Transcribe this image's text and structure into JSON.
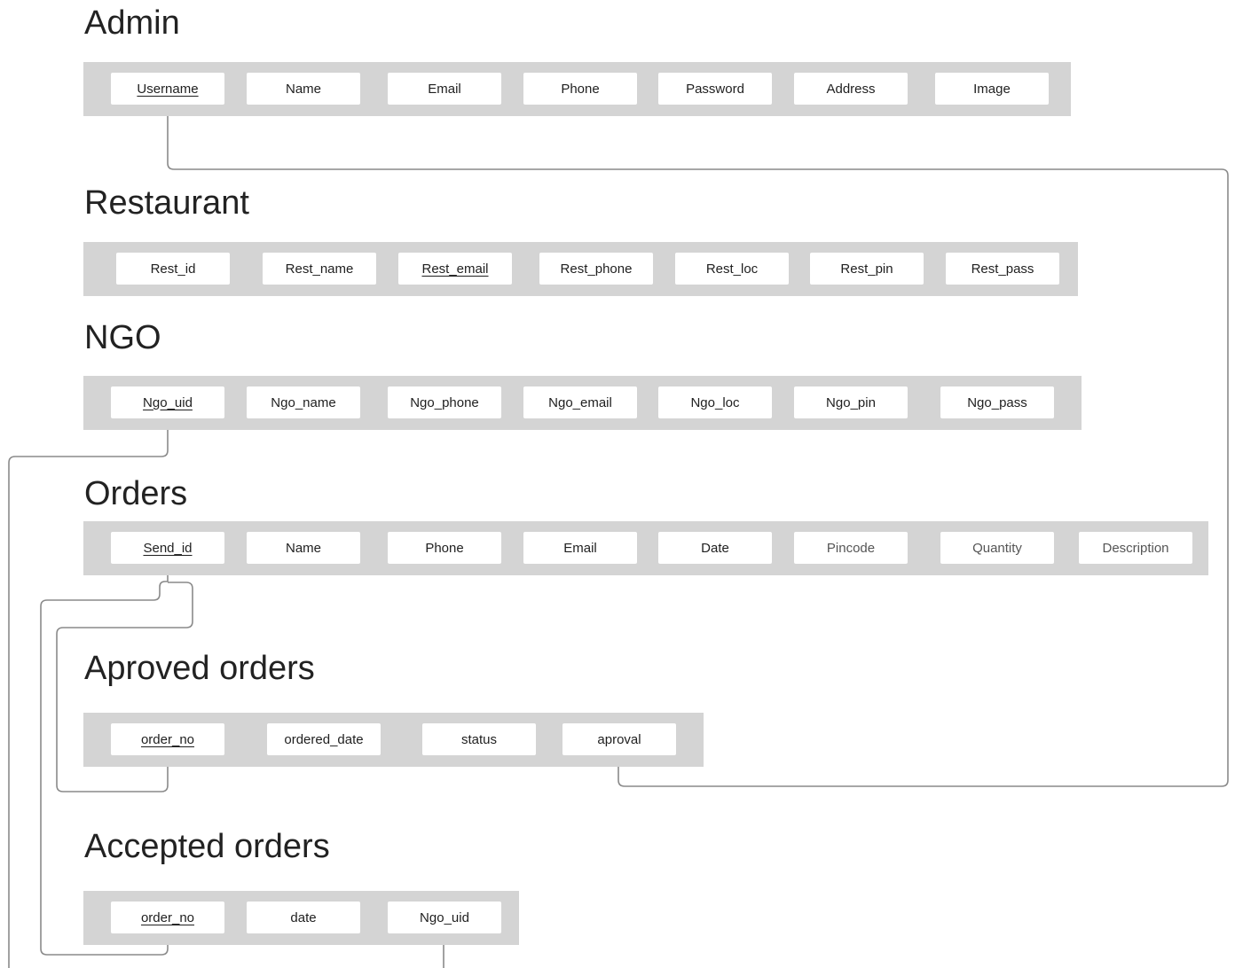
{
  "tables": {
    "admin": {
      "title": "Admin",
      "fields": [
        "Username",
        "Name",
        "Email",
        "Phone",
        "Password",
        "Address",
        "Image"
      ]
    },
    "restaurant": {
      "title": "Restaurant",
      "fields": [
        "Rest_id",
        "Rest_name",
        "Rest_email",
        "Rest_phone",
        "Rest_loc",
        "Rest_pin",
        "Rest_pass"
      ]
    },
    "ngo": {
      "title": "NGO",
      "fields": [
        "Ngo_uid",
        "Ngo_name",
        "Ngo_phone",
        "Ngo_email",
        "Ngo_loc",
        "Ngo_pin",
        "Ngo_pass"
      ]
    },
    "orders": {
      "title": "Orders",
      "fields": [
        "Send_id",
        "Name",
        "Phone",
        "Email",
        "Date",
        "Pincode",
        "Quantity",
        "Description"
      ]
    },
    "approved": {
      "title": "Aproved orders",
      "fields": [
        "order_no",
        "ordered_date",
        "status",
        "aproval"
      ]
    },
    "accepted": {
      "title": "Accepted orders",
      "fields": [
        "order_no",
        "date",
        "Ngo_uid"
      ]
    }
  },
  "colors": {
    "table_bar": "#d4d4d4",
    "field_box": "#ffffff",
    "connector": "#8a8a8a",
    "text": "#222222"
  }
}
